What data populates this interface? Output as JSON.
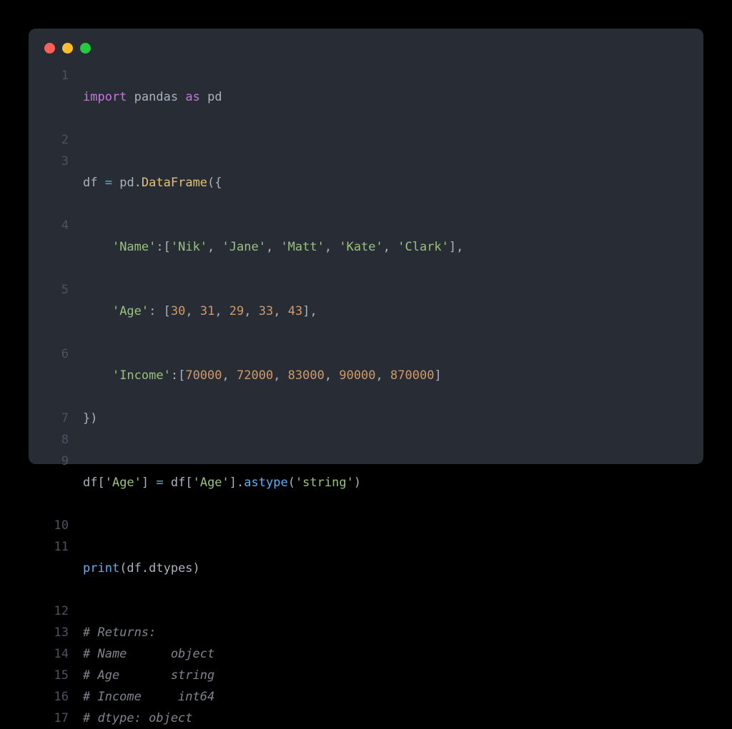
{
  "window": {
    "traffic_lights": [
      "red",
      "yellow",
      "green"
    ]
  },
  "code": {
    "line_count": 17,
    "tokens": {
      "l1": {
        "import": "import",
        "sp1": " ",
        "pandas": "pandas",
        "sp2": " ",
        "as": "as",
        "sp3": " ",
        "pd": "pd"
      },
      "l2": "",
      "l3": {
        "a": "df ",
        "eq": "=",
        "b": " pd.",
        "cls": "DataFrame",
        "c": "({"
      },
      "l4": {
        "indent": "    ",
        "k": "'Name'",
        "colon": ":[",
        "v1": "'Nik'",
        "c1": ", ",
        "v2": "'Jane'",
        "c2": ", ",
        "v3": "'Matt'",
        "c3": ", ",
        "v4": "'Kate'",
        "c4": ", ",
        "v5": "'Clark'",
        "end": "],"
      },
      "l5": {
        "indent": "    ",
        "k": "'Age'",
        "colon": ": [",
        "n1": "30",
        "c1": ", ",
        "n2": "31",
        "c2": ", ",
        "n3": "29",
        "c3": ", ",
        "n4": "33",
        "c4": ", ",
        "n5": "43",
        "end": "],"
      },
      "l6": {
        "indent": "    ",
        "k": "'Income'",
        "colon": ":[",
        "n1": "70000",
        "c1": ", ",
        "n2": "72000",
        "c2": ", ",
        "n3": "83000",
        "c3": ", ",
        "n4": "90000",
        "c4": ", ",
        "n5": "870000",
        "end": "]"
      },
      "l7": "})",
      "l8": "",
      "l9": {
        "a": "df[",
        "s1": "'Age'",
        "b": "] ",
        "eq": "=",
        "c": " df[",
        "s2": "'Age'",
        "d": "].",
        "fn": "astype",
        "e": "(",
        "s3": "'string'",
        "f": ")"
      },
      "l10": "",
      "l11": {
        "fn": "print",
        "a": "(df.dtypes)"
      },
      "l12": "",
      "l13": "# Returns:",
      "l14": "# Name      object",
      "l15": "# Age       string",
      "l16": "# Income     int64",
      "l17": "# dtype: object"
    }
  }
}
